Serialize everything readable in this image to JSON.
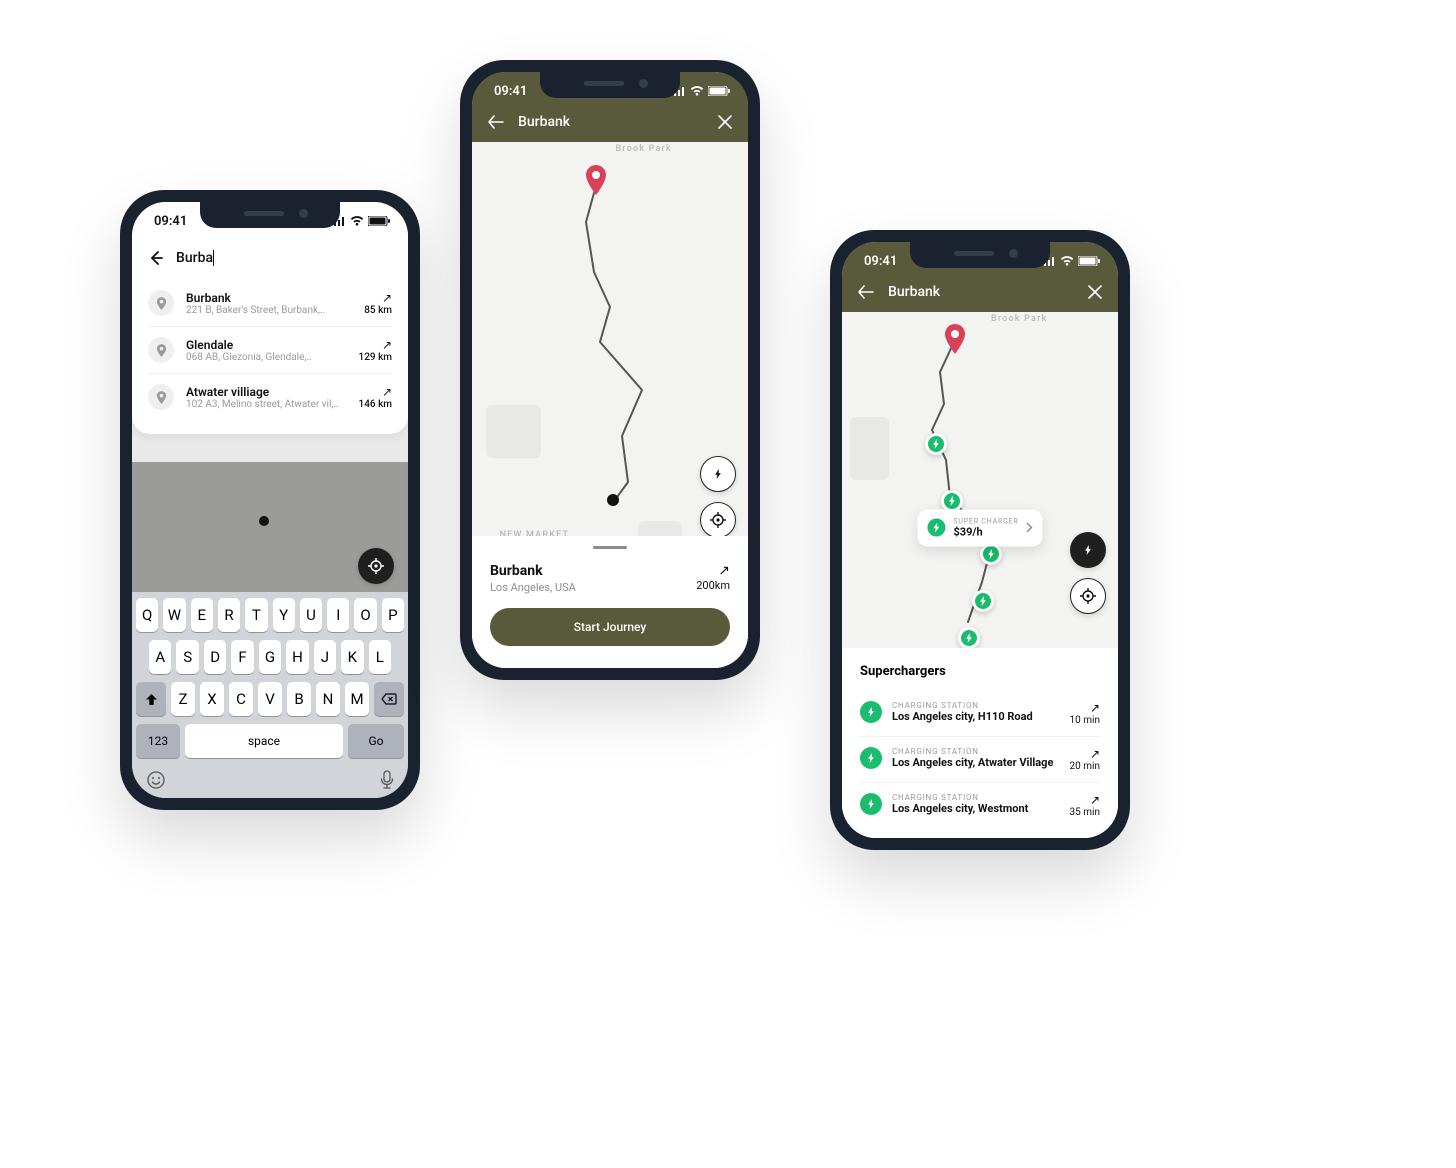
{
  "status": {
    "time": "09:41"
  },
  "phone1": {
    "search": {
      "query": "Burba"
    },
    "suggestions": [
      {
        "name": "Burbank",
        "address": "221 B, Baker's Street, Burbank,..",
        "distance": "85 km"
      },
      {
        "name": "Glendale",
        "address": "068 AB, Glezonia, Glendale,..",
        "distance": "129 km"
      },
      {
        "name": "Atwater villiage",
        "address": "102 A3, Melino street, Atwater vil,..",
        "distance": "146 km"
      }
    ],
    "keyboard": {
      "row1": [
        "Q",
        "W",
        "E",
        "R",
        "T",
        "Y",
        "U",
        "I",
        "O",
        "P"
      ],
      "row2": [
        "A",
        "S",
        "D",
        "F",
        "G",
        "H",
        "J",
        "K",
        "L"
      ],
      "row3": [
        "Z",
        "X",
        "C",
        "V",
        "B",
        "N",
        "M"
      ],
      "num": "123",
      "space": "space",
      "go": "Go"
    }
  },
  "phone2": {
    "header": {
      "title": "Burbank"
    },
    "map_labels": {
      "top": "Brook Park",
      "bottom": "NEW MARKET"
    },
    "card": {
      "name": "Burbank",
      "sub": "Los Angeles, USA",
      "distance": "200km",
      "cta": "Start Journey"
    }
  },
  "phone3": {
    "header": {
      "title": "Burbank"
    },
    "map_labels": {
      "top": "Brook Park"
    },
    "popup": {
      "label": "SUPER CHARGER",
      "price": "$39/h"
    },
    "card": {
      "title": "Superchargers",
      "label": "CHARGING STATION",
      "items": [
        {
          "name": "Los Angeles city, H110 Road",
          "time": "10 min"
        },
        {
          "name": "Los Angeles city, Atwater Village",
          "time": "20 min"
        },
        {
          "name": "Los Angeles city, Westmont",
          "time": "35 min"
        }
      ]
    }
  }
}
